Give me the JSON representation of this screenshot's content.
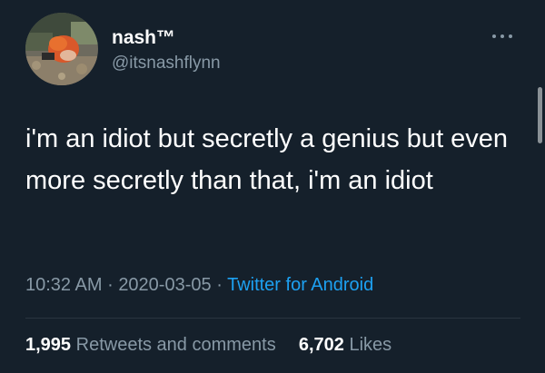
{
  "tweet": {
    "display_name": "nash™",
    "handle": "@itsnashflynn",
    "text": "i'm an idiot but secretly a genius but even more secretly than that, i'm an idiot",
    "time": "10:32 AM",
    "separator": "·",
    "date": "2020-03-05",
    "source": "Twitter for Android",
    "retweets_count": "1,995",
    "retweets_label": "Retweets and comments",
    "likes_count": "6,702",
    "likes_label": "Likes"
  },
  "icons": {
    "more": "more-horizontal-icon",
    "avatar": "profile-photo"
  },
  "colors": {
    "background": "#15202b",
    "primary_text": "#ffffff",
    "secondary_text": "#8899a6",
    "link": "#1da1f2"
  }
}
